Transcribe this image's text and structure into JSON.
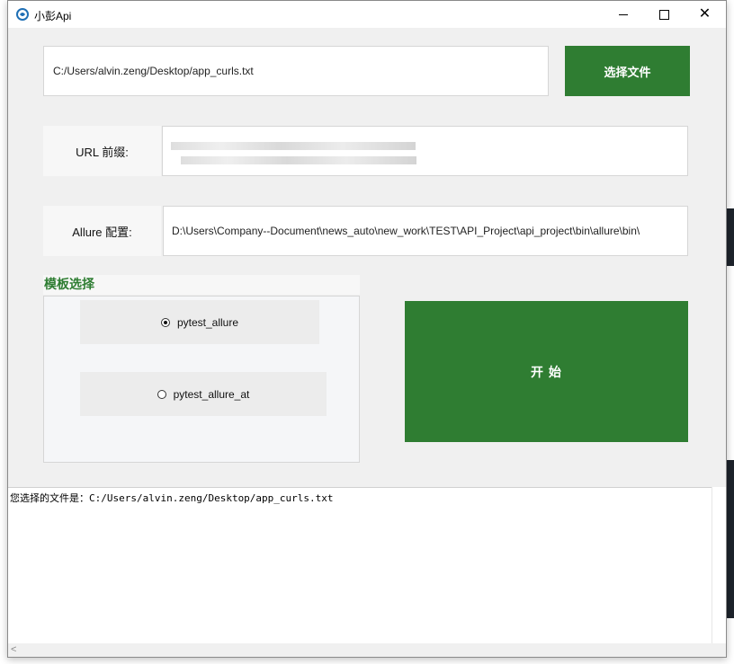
{
  "window": {
    "title": "小彭Api"
  },
  "file": {
    "path_value": "C:/Users/alvin.zeng/Desktop/app_curls.txt",
    "select_button_label": "选择文件"
  },
  "url_prefix": {
    "label": "URL 前缀:"
  },
  "allure": {
    "label": "Allure 配置:",
    "value": "D:\\Users\\Company--Document\\news_auto\\new_work\\TEST\\API_Project\\api_project\\bin\\allure\\bin\\"
  },
  "template": {
    "section_title": "模板选择",
    "options": [
      {
        "label": "pytest_allure",
        "checked": true
      },
      {
        "label": "pytest_allure_at",
        "checked": false
      }
    ]
  },
  "start_button_label": "开 始",
  "log": {
    "text": "您选择的文件是：C:/Users/alvin.zeng/Desktop/app_curls.txt"
  },
  "scrollbar": {
    "left_arrow": "<"
  },
  "colors": {
    "accent_green": "#2f7d32",
    "section_title_green": "#2e7d32"
  }
}
